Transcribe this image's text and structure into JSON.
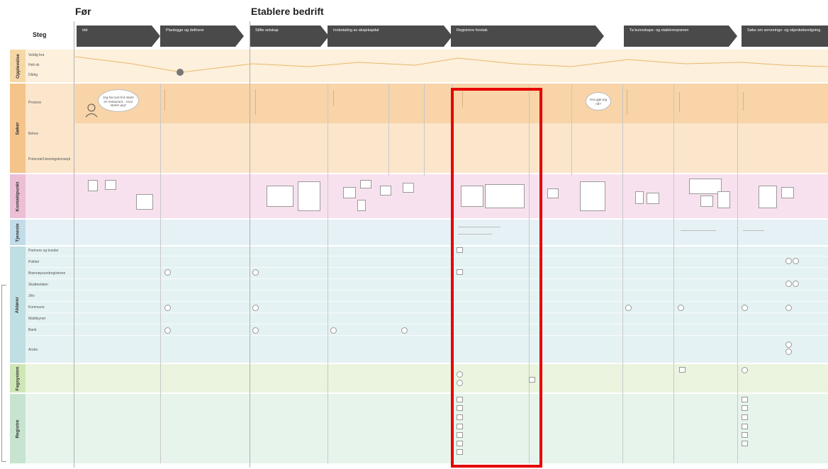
{
  "phases": {
    "before": "Før",
    "establish": "Etablere bedrift"
  },
  "steg_label": "Steg",
  "steps": [
    {
      "label": "Idé"
    },
    {
      "label": "Planlegge og definere"
    },
    {
      "label": "Stifte selskap"
    },
    {
      "label": "Innbetaling av aksjekapital"
    },
    {
      "label": "Registrere foretak"
    },
    {
      "label": "Ta kunnskaps- og etablererprøven"
    },
    {
      "label": "Søke om serverings- og skjenkebevilgning"
    }
  ],
  "bands": [
    {
      "label": "Opplevelse",
      "rows": [
        "Veldig bra",
        "Helt ok",
        "Dårlig"
      ]
    },
    {
      "label": "Søker",
      "rows": [
        "Prosess",
        "Behov",
        "Potensiell løsningskonsept"
      ]
    },
    {
      "label": "Kontaktpunkt",
      "rows": []
    },
    {
      "label": "Tjeneste",
      "rows": []
    },
    {
      "label": "Aktører",
      "rows": [
        "Partnere og kunder",
        "Politiet",
        "Brønnøysundregistrene",
        "Skatteetaten",
        "Jhlv",
        "Kommune",
        "Mattilsynet",
        "Bank",
        "Andre"
      ]
    },
    {
      "label": "Fagsystem",
      "rows": []
    },
    {
      "label": "Registre",
      "rows": []
    }
  ],
  "bubbles": [
    "Jeg har lyst til å starte en restaurant... Hvor starter jeg?",
    "Hva gjør jeg nå?"
  ],
  "highlight_color": "#e60000"
}
